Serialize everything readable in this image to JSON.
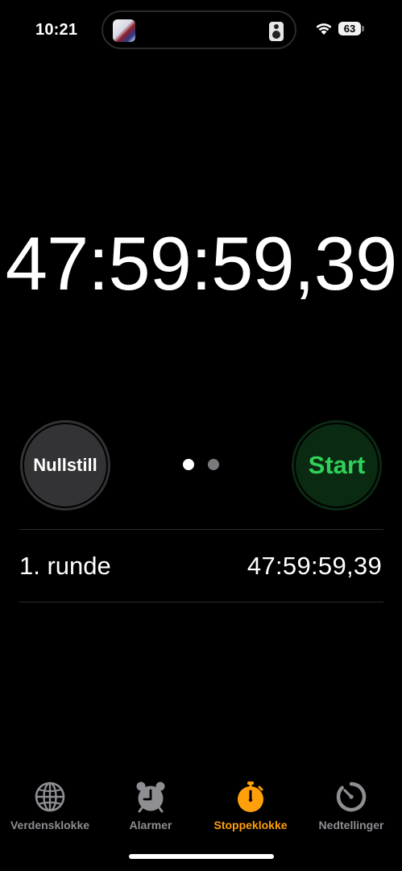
{
  "status_bar": {
    "time": "10:21",
    "battery": "63",
    "icons": [
      "wifi-icon",
      "battery-icon"
    ]
  },
  "dynamic_island": {
    "icons": [
      "media-thumbnail",
      "speaker-icon"
    ]
  },
  "stopwatch": {
    "display_time": "47:59:59,39",
    "reset_label": "Nullstill",
    "start_label": "Start",
    "page_count": 2,
    "current_page": 1
  },
  "laps": [
    {
      "label": "1. runde",
      "time": "47:59:59,39"
    }
  ],
  "tab_bar": {
    "tabs": [
      {
        "label": "Verdensklokke",
        "icon": "globe-icon",
        "active": false
      },
      {
        "label": "Alarmer",
        "icon": "alarm-clock-icon",
        "active": false
      },
      {
        "label": "Stoppeklokke",
        "icon": "stopwatch-icon",
        "active": true
      },
      {
        "label": "Nedtellinger",
        "icon": "timer-icon",
        "active": false
      }
    ]
  },
  "colors": {
    "background": "#000000",
    "accent": "#ff9f0a",
    "start_text": "#30d158",
    "start_bg": "#0b2a12",
    "reset_bg": "#333336",
    "inactive": "#8e8e93"
  }
}
